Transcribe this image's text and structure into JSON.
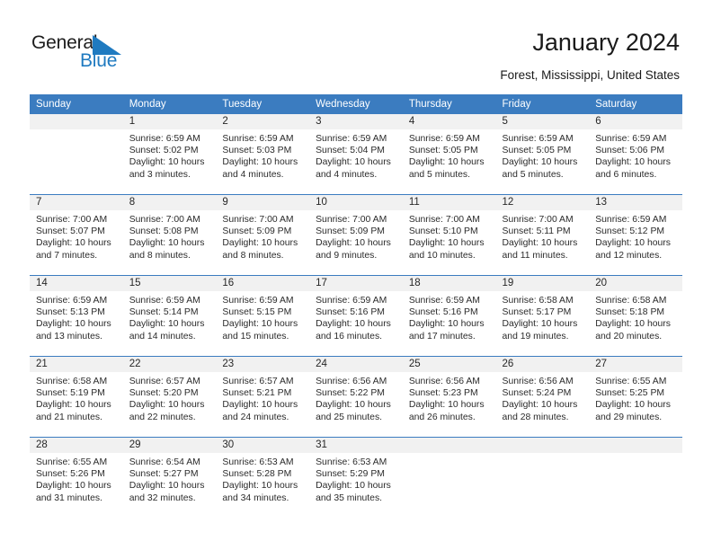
{
  "brand": {
    "name_top": "General",
    "name_bottom": "Blue",
    "triangle_color": "#1f7ac0",
    "text_color": "#1c1c1c"
  },
  "header": {
    "title": "January 2024",
    "location": "Forest, Mississippi, United States"
  },
  "theme": {
    "header_blue": "#3b7cc0",
    "daynum_bg": "#f1f1f1",
    "text": "#2b2b2b"
  },
  "weekdays": [
    "Sunday",
    "Monday",
    "Tuesday",
    "Wednesday",
    "Thursday",
    "Friday",
    "Saturday"
  ],
  "labels": {
    "sunrise_prefix": "Sunrise: ",
    "sunset_prefix": "Sunset: ",
    "daylight_prefix": "Daylight: "
  },
  "weeks": [
    [
      {
        "day": "",
        "sunrise": "",
        "sunset": "",
        "daylight": ""
      },
      {
        "day": "1",
        "sunrise": "Sunrise: 6:59 AM",
        "sunset": "Sunset: 5:02 PM",
        "daylight": "Daylight: 10 hours and 3 minutes."
      },
      {
        "day": "2",
        "sunrise": "Sunrise: 6:59 AM",
        "sunset": "Sunset: 5:03 PM",
        "daylight": "Daylight: 10 hours and 4 minutes."
      },
      {
        "day": "3",
        "sunrise": "Sunrise: 6:59 AM",
        "sunset": "Sunset: 5:04 PM",
        "daylight": "Daylight: 10 hours and 4 minutes."
      },
      {
        "day": "4",
        "sunrise": "Sunrise: 6:59 AM",
        "sunset": "Sunset: 5:05 PM",
        "daylight": "Daylight: 10 hours and 5 minutes."
      },
      {
        "day": "5",
        "sunrise": "Sunrise: 6:59 AM",
        "sunset": "Sunset: 5:05 PM",
        "daylight": "Daylight: 10 hours and 5 minutes."
      },
      {
        "day": "6",
        "sunrise": "Sunrise: 6:59 AM",
        "sunset": "Sunset: 5:06 PM",
        "daylight": "Daylight: 10 hours and 6 minutes."
      }
    ],
    [
      {
        "day": "7",
        "sunrise": "Sunrise: 7:00 AM",
        "sunset": "Sunset: 5:07 PM",
        "daylight": "Daylight: 10 hours and 7 minutes."
      },
      {
        "day": "8",
        "sunrise": "Sunrise: 7:00 AM",
        "sunset": "Sunset: 5:08 PM",
        "daylight": "Daylight: 10 hours and 8 minutes."
      },
      {
        "day": "9",
        "sunrise": "Sunrise: 7:00 AM",
        "sunset": "Sunset: 5:09 PM",
        "daylight": "Daylight: 10 hours and 8 minutes."
      },
      {
        "day": "10",
        "sunrise": "Sunrise: 7:00 AM",
        "sunset": "Sunset: 5:09 PM",
        "daylight": "Daylight: 10 hours and 9 minutes."
      },
      {
        "day": "11",
        "sunrise": "Sunrise: 7:00 AM",
        "sunset": "Sunset: 5:10 PM",
        "daylight": "Daylight: 10 hours and 10 minutes."
      },
      {
        "day": "12",
        "sunrise": "Sunrise: 7:00 AM",
        "sunset": "Sunset: 5:11 PM",
        "daylight": "Daylight: 10 hours and 11 minutes."
      },
      {
        "day": "13",
        "sunrise": "Sunrise: 6:59 AM",
        "sunset": "Sunset: 5:12 PM",
        "daylight": "Daylight: 10 hours and 12 minutes."
      }
    ],
    [
      {
        "day": "14",
        "sunrise": "Sunrise: 6:59 AM",
        "sunset": "Sunset: 5:13 PM",
        "daylight": "Daylight: 10 hours and 13 minutes."
      },
      {
        "day": "15",
        "sunrise": "Sunrise: 6:59 AM",
        "sunset": "Sunset: 5:14 PM",
        "daylight": "Daylight: 10 hours and 14 minutes."
      },
      {
        "day": "16",
        "sunrise": "Sunrise: 6:59 AM",
        "sunset": "Sunset: 5:15 PM",
        "daylight": "Daylight: 10 hours and 15 minutes."
      },
      {
        "day": "17",
        "sunrise": "Sunrise: 6:59 AM",
        "sunset": "Sunset: 5:16 PM",
        "daylight": "Daylight: 10 hours and 16 minutes."
      },
      {
        "day": "18",
        "sunrise": "Sunrise: 6:59 AM",
        "sunset": "Sunset: 5:16 PM",
        "daylight": "Daylight: 10 hours and 17 minutes."
      },
      {
        "day": "19",
        "sunrise": "Sunrise: 6:58 AM",
        "sunset": "Sunset: 5:17 PM",
        "daylight": "Daylight: 10 hours and 19 minutes."
      },
      {
        "day": "20",
        "sunrise": "Sunrise: 6:58 AM",
        "sunset": "Sunset: 5:18 PM",
        "daylight": "Daylight: 10 hours and 20 minutes."
      }
    ],
    [
      {
        "day": "21",
        "sunrise": "Sunrise: 6:58 AM",
        "sunset": "Sunset: 5:19 PM",
        "daylight": "Daylight: 10 hours and 21 minutes."
      },
      {
        "day": "22",
        "sunrise": "Sunrise: 6:57 AM",
        "sunset": "Sunset: 5:20 PM",
        "daylight": "Daylight: 10 hours and 22 minutes."
      },
      {
        "day": "23",
        "sunrise": "Sunrise: 6:57 AM",
        "sunset": "Sunset: 5:21 PM",
        "daylight": "Daylight: 10 hours and 24 minutes."
      },
      {
        "day": "24",
        "sunrise": "Sunrise: 6:56 AM",
        "sunset": "Sunset: 5:22 PM",
        "daylight": "Daylight: 10 hours and 25 minutes."
      },
      {
        "day": "25",
        "sunrise": "Sunrise: 6:56 AM",
        "sunset": "Sunset: 5:23 PM",
        "daylight": "Daylight: 10 hours and 26 minutes."
      },
      {
        "day": "26",
        "sunrise": "Sunrise: 6:56 AM",
        "sunset": "Sunset: 5:24 PM",
        "daylight": "Daylight: 10 hours and 28 minutes."
      },
      {
        "day": "27",
        "sunrise": "Sunrise: 6:55 AM",
        "sunset": "Sunset: 5:25 PM",
        "daylight": "Daylight: 10 hours and 29 minutes."
      }
    ],
    [
      {
        "day": "28",
        "sunrise": "Sunrise: 6:55 AM",
        "sunset": "Sunset: 5:26 PM",
        "daylight": "Daylight: 10 hours and 31 minutes."
      },
      {
        "day": "29",
        "sunrise": "Sunrise: 6:54 AM",
        "sunset": "Sunset: 5:27 PM",
        "daylight": "Daylight: 10 hours and 32 minutes."
      },
      {
        "day": "30",
        "sunrise": "Sunrise: 6:53 AM",
        "sunset": "Sunset: 5:28 PM",
        "daylight": "Daylight: 10 hours and 34 minutes."
      },
      {
        "day": "31",
        "sunrise": "Sunrise: 6:53 AM",
        "sunset": "Sunset: 5:29 PM",
        "daylight": "Daylight: 10 hours and 35 minutes."
      },
      {
        "day": "",
        "sunrise": "",
        "sunset": "",
        "daylight": ""
      },
      {
        "day": "",
        "sunrise": "",
        "sunset": "",
        "daylight": ""
      },
      {
        "day": "",
        "sunrise": "",
        "sunset": "",
        "daylight": ""
      }
    ]
  ]
}
